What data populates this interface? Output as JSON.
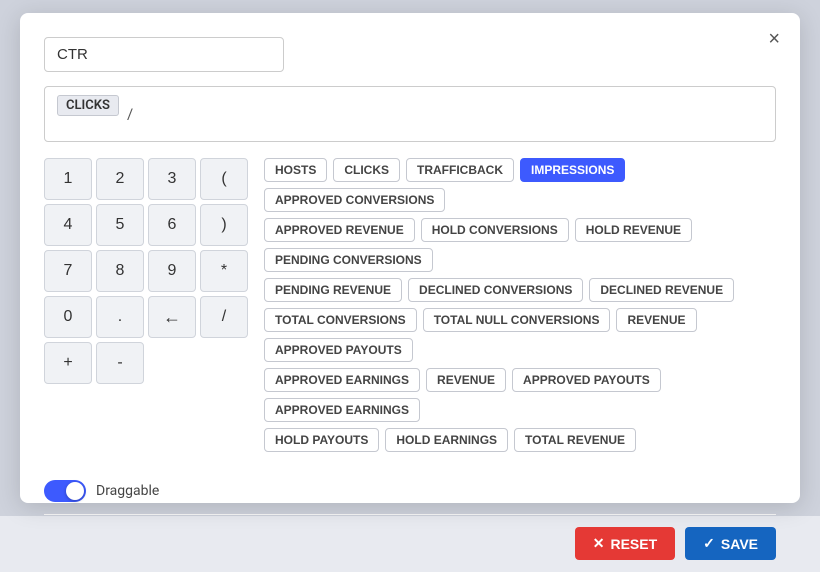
{
  "modal": {
    "title_value": "CTR",
    "close_label": "×",
    "formula": {
      "token": "CLICKS",
      "divider": "/"
    }
  },
  "numpad": {
    "buttons": [
      "1",
      "2",
      "3",
      "(",
      ")",
      "4",
      "5",
      "6",
      "*",
      "/",
      "7",
      "8",
      "9",
      "+",
      "-",
      "0",
      ".",
      "←",
      "",
      ""
    ]
  },
  "tags": {
    "rows": [
      [
        "HOSTS",
        "CLICKS",
        "TRAFFICBACK",
        "IMPRESSIONS",
        "APPROVED CONVERSIONS"
      ],
      [
        "APPROVED REVENUE",
        "HOLD CONVERSIONS",
        "HOLD REVENUE",
        "PENDING CONVERSIONS"
      ],
      [
        "PENDING REVENUE",
        "DECLINED CONVERSIONS",
        "DECLINED REVENUE"
      ],
      [
        "TOTAL CONVERSIONS",
        "TOTAL NULL CONVERSIONS",
        "REVENUE",
        "APPROVED PAYOUTS"
      ],
      [
        "APPROVED EARNINGS",
        "REVENUE",
        "APPROVED PAYOUTS",
        "APPROVED EARNINGS"
      ],
      [
        "HOLD PAYOUTS",
        "HOLD EARNINGS",
        "TOTAL REVENUE"
      ]
    ],
    "active": "IMPRESSIONS"
  },
  "draggable": {
    "label": "Draggable"
  },
  "footer": {
    "reset_label": "RESET",
    "save_label": "SAVE"
  }
}
